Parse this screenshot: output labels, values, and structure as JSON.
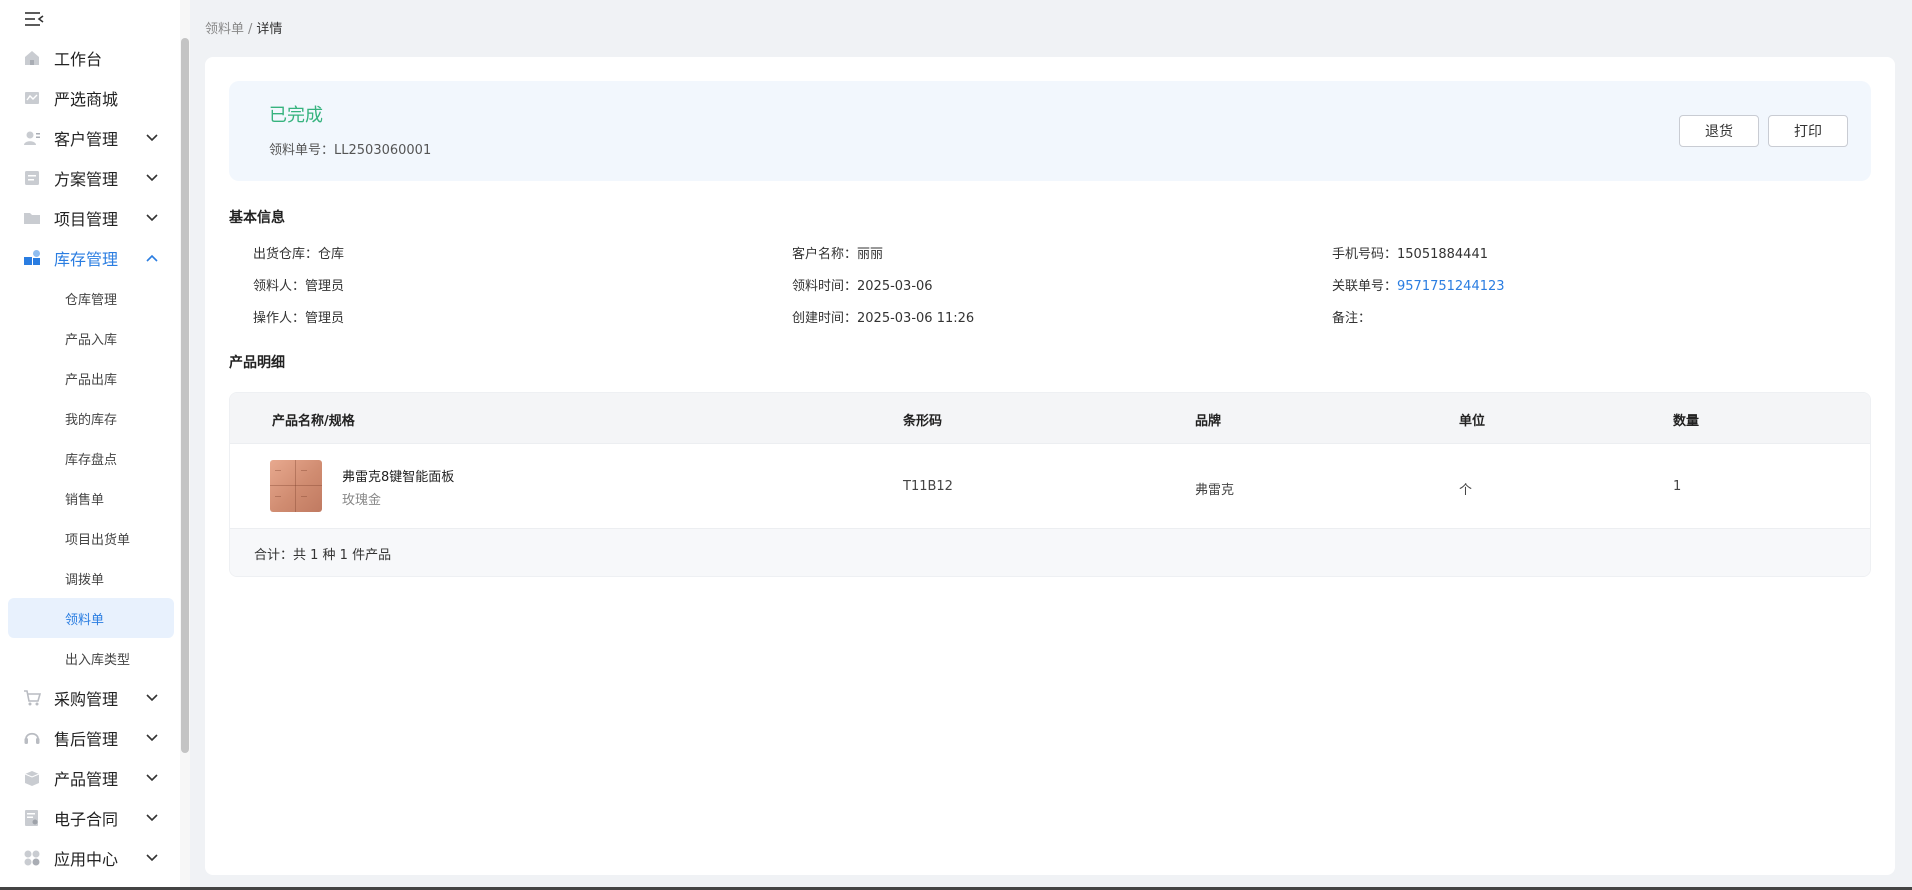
{
  "sidebar": {
    "menu": [
      {
        "label": "工作台",
        "icon": "home-icon",
        "has_children": false
      },
      {
        "label": "严选商城",
        "icon": "mall-icon",
        "has_children": false
      },
      {
        "label": "客户管理",
        "icon": "customer-icon",
        "has_children": true
      },
      {
        "label": "方案管理",
        "icon": "plan-icon",
        "has_children": true
      },
      {
        "label": "项目管理",
        "icon": "folder-icon",
        "has_children": true
      },
      {
        "label": "库存管理",
        "icon": "inventory-icon",
        "has_children": true,
        "expanded": true
      }
    ],
    "submenu": [
      {
        "label": "仓库管理"
      },
      {
        "label": "产品入库"
      },
      {
        "label": "产品出库"
      },
      {
        "label": "我的库存"
      },
      {
        "label": "库存盘点"
      },
      {
        "label": "销售单"
      },
      {
        "label": "项目出货单"
      },
      {
        "label": "调拨单"
      },
      {
        "label": "领料单",
        "active": true
      },
      {
        "label": "出入库类型"
      }
    ],
    "menu_after": [
      {
        "label": "采购管理",
        "icon": "cart-icon"
      },
      {
        "label": "售后管理",
        "icon": "headset-icon"
      },
      {
        "label": "产品管理",
        "icon": "box-icon"
      },
      {
        "label": "电子合同",
        "icon": "contract-icon"
      },
      {
        "label": "应用中心",
        "icon": "apps-icon"
      }
    ]
  },
  "breadcrumb": {
    "parent": "领料单",
    "separator": "/",
    "current": "详情"
  },
  "status": {
    "text": "已完成",
    "order_no_label": "领料单号：",
    "order_no": "LL2503060001"
  },
  "actions": {
    "return_label": "退货",
    "print_label": "打印"
  },
  "basic_info": {
    "title": "基本信息",
    "rows": [
      [
        {
          "key": "出货仓库：",
          "value": "仓库"
        },
        {
          "key": "客户名称：",
          "value": "丽丽"
        },
        {
          "key": "手机号码：",
          "value": "15051884441"
        }
      ],
      [
        {
          "key": "领料人：",
          "value": "管理员"
        },
        {
          "key": "领料时间：",
          "value": "2025-03-06"
        },
        {
          "key": "关联单号：",
          "value": "9571751244123",
          "link": true
        }
      ],
      [
        {
          "key": "操作人：",
          "value": "管理员"
        },
        {
          "key": "创建时间：",
          "value": "2025-03-06 11:26"
        },
        {
          "key": "备注：",
          "value": ""
        }
      ]
    ]
  },
  "products": {
    "title": "产品明细",
    "columns": {
      "name": "产品名称/规格",
      "barcode": "条形码",
      "brand": "品牌",
      "unit": "单位",
      "qty": "数量"
    },
    "rows": [
      {
        "name": "弗雷克8键智能面板",
        "spec": "玫瑰金",
        "barcode": "T11B12",
        "brand": "弗雷克",
        "unit": "个",
        "qty": "1"
      }
    ],
    "summary": "合计：共 1 种 1 件产品"
  },
  "colors": {
    "accent": "#2a7de1",
    "status_green": "#36b37e",
    "status_panel_bg": "#f2f7fd"
  }
}
